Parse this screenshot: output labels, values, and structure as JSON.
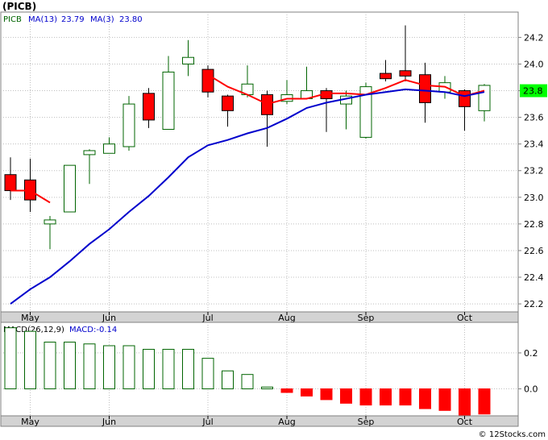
{
  "title": "(PICB)",
  "price_panel": {
    "symbol": "PICB",
    "ma13_label": "MA(13)",
    "ma13_value": "23.79",
    "ma3_label": "MA(3)",
    "ma3_value": "23.80",
    "last_price": "23.8",
    "y_ticks": [
      22.2,
      22.4,
      22.6,
      22.8,
      23.0,
      23.2,
      23.4,
      23.6,
      23.8,
      24.0,
      24.2
    ],
    "ylim": [
      22.14,
      24.39
    ]
  },
  "macd_panel": {
    "label": "MACD(26,12,9)",
    "value_label": "MACD:-0.14",
    "y_ticks": [
      "0.2",
      "0.0"
    ],
    "ylim": [
      -0.15,
      0.37
    ]
  },
  "x_labels": [
    "May",
    "Jun",
    "Jul",
    "Aug",
    "Sep",
    "Oct"
  ],
  "watermark": "© 12Stocks.com",
  "colors": {
    "up": "#006400",
    "down": "#ff0000",
    "ma13": "#0000cc",
    "ma3": "#ff0000",
    "price_badge": "#00ff00"
  },
  "chart_data": {
    "type": "candlestick",
    "x_index": [
      0,
      1,
      2,
      3,
      4,
      5,
      6,
      7,
      8,
      9,
      10,
      11,
      12,
      13,
      14,
      15,
      16,
      17,
      18,
      19,
      20,
      21,
      22,
      23,
      24
    ],
    "month_start_index": {
      "May": 1,
      "Jun": 5,
      "Jul": 10,
      "Aug": 14,
      "Sep": 18,
      "Oct": 23
    },
    "candles": [
      {
        "open": 23.17,
        "close": 23.05,
        "high": 23.3,
        "low": 22.98
      },
      {
        "open": 23.13,
        "close": 22.98,
        "high": 23.29,
        "low": 22.89
      },
      {
        "open": 22.8,
        "close": 22.83,
        "high": 22.86,
        "low": 22.61
      },
      {
        "open": 22.89,
        "close": 23.24,
        "high": 23.24,
        "low": 22.89
      },
      {
        "open": 23.32,
        "close": 23.35,
        "high": 23.36,
        "low": 23.1
      },
      {
        "open": 23.33,
        "close": 23.4,
        "high": 23.45,
        "low": 23.33
      },
      {
        "open": 23.38,
        "close": 23.7,
        "high": 23.76,
        "low": 23.35
      },
      {
        "open": 23.78,
        "close": 23.58,
        "high": 23.82,
        "low": 23.52
      },
      {
        "open": 23.51,
        "close": 23.94,
        "high": 24.06,
        "low": 23.51
      },
      {
        "open": 24.0,
        "close": 24.05,
        "high": 24.18,
        "low": 23.91
      },
      {
        "open": 23.96,
        "close": 23.79,
        "high": 23.99,
        "low": 23.75
      },
      {
        "open": 23.76,
        "close": 23.65,
        "high": 23.77,
        "low": 23.53
      },
      {
        "open": 23.77,
        "close": 23.85,
        "high": 23.99,
        "low": 23.75
      },
      {
        "open": 23.77,
        "close": 23.62,
        "high": 23.8,
        "low": 23.38
      },
      {
        "open": 23.72,
        "close": 23.77,
        "high": 23.88,
        "low": 23.7
      },
      {
        "open": 23.74,
        "close": 23.8,
        "high": 23.98,
        "low": 23.74
      },
      {
        "open": 23.8,
        "close": 23.74,
        "high": 23.82,
        "low": 23.49
      },
      {
        "open": 23.7,
        "close": 23.76,
        "high": 23.8,
        "low": 23.51
      },
      {
        "open": 23.45,
        "close": 23.83,
        "high": 23.86,
        "low": 23.44
      },
      {
        "open": 23.93,
        "close": 23.89,
        "high": 24.03,
        "low": 23.87
      },
      {
        "open": 23.95,
        "close": 23.91,
        "high": 24.29,
        "low": 23.87
      },
      {
        "open": 23.92,
        "close": 23.71,
        "high": 24.01,
        "low": 23.56
      },
      {
        "open": 23.79,
        "close": 23.86,
        "high": 23.91,
        "low": 23.74
      },
      {
        "open": 23.8,
        "close": 23.68,
        "high": 23.81,
        "low": 23.5
      },
      {
        "open": 23.65,
        "close": 23.84,
        "high": 23.85,
        "low": 23.57
      }
    ],
    "ma13": [
      22.2,
      22.31,
      22.4,
      22.52,
      22.65,
      22.76,
      22.89,
      23.01,
      23.15,
      23.3,
      23.39,
      23.43,
      23.48,
      23.52,
      23.59,
      23.67,
      23.71,
      23.74,
      23.77,
      23.79,
      23.81,
      23.8,
      23.79,
      23.76,
      23.79
    ],
    "ma3": [
      23.05,
      23.05,
      22.96,
      null,
      null,
      null,
      null,
      null,
      null,
      null,
      23.92,
      23.83,
      23.77,
      23.7,
      23.74,
      23.74,
      23.78,
      23.78,
      23.77,
      23.82,
      23.88,
      23.84,
      23.83,
      23.76,
      23.8
    ],
    "macd": [
      0.34,
      0.32,
      0.26,
      0.26,
      0.25,
      0.24,
      0.24,
      0.22,
      0.22,
      0.22,
      0.17,
      0.1,
      0.08,
      0.01,
      -0.02,
      -0.04,
      -0.06,
      -0.08,
      -0.09,
      -0.09,
      -0.09,
      -0.11,
      -0.12,
      -0.15,
      -0.14
    ]
  }
}
